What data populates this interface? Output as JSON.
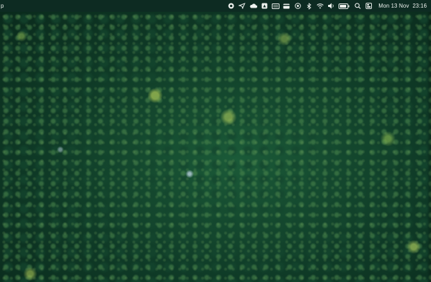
{
  "menubar": {
    "app_fragment": "p",
    "status_icons": [
      "record-icon",
      "paper-plane-icon",
      "cloud-sync-icon",
      "drive-icon",
      "keyboard-icon",
      "card-icon",
      "target-icon",
      "bluetooth-icon",
      "wifi-icon",
      "volume-icon",
      "battery-icon",
      "search-icon",
      "control-center-icon"
    ],
    "date": "Mon 13 Nov",
    "time": "23:16"
  },
  "desktop": {
    "wallpaper": "forest-canopy-aerial",
    "colors": {
      "canopy_dark": "#0a2a1c",
      "canopy_mid": "#1b5a38",
      "highlight": "#a6c454",
      "menubar_bg": "#0d2b22"
    }
  }
}
